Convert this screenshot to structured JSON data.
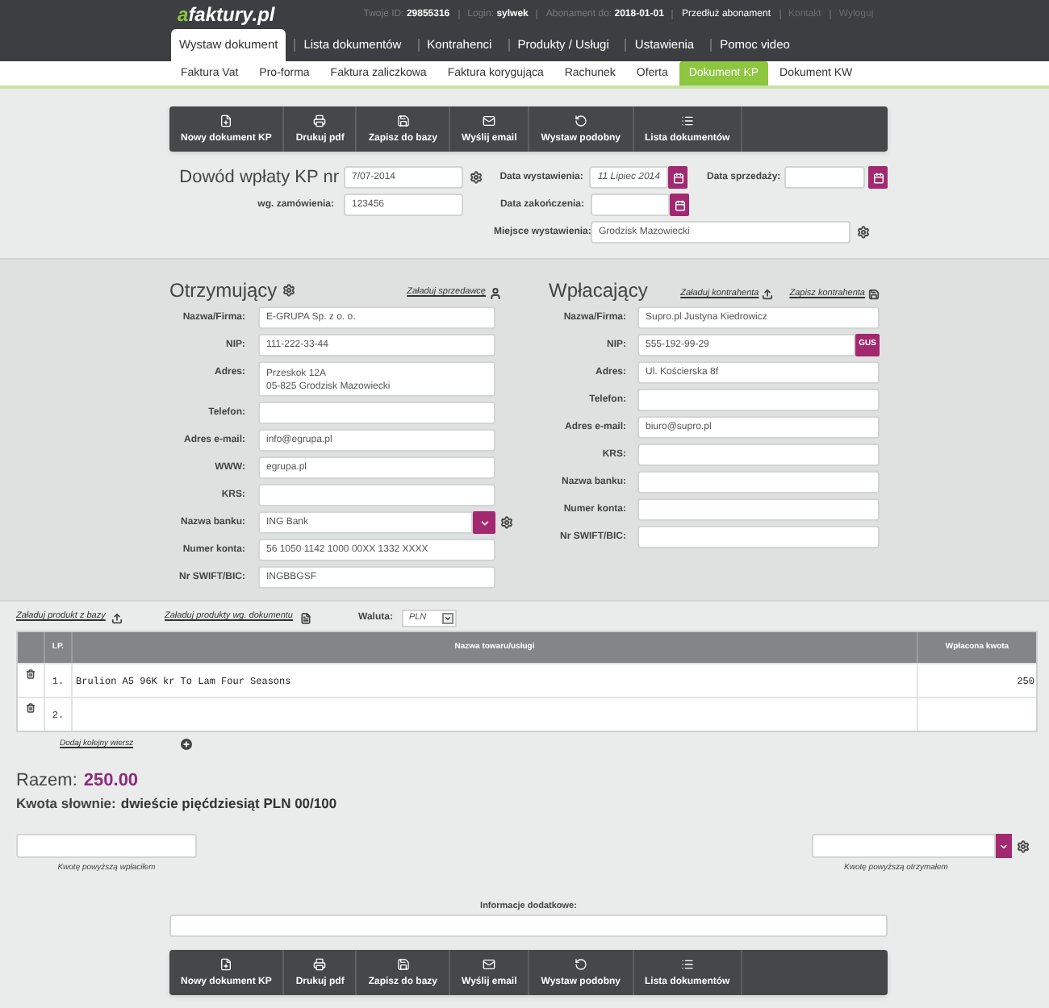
{
  "header": {
    "logo": {
      "accent": "a",
      "text": "faktury.pl"
    },
    "account": [
      {
        "label": "Twoje ID:",
        "value": "29855316"
      },
      {
        "label": "Login:",
        "value": "sylwek"
      },
      {
        "label": "Abonament do:",
        "value": "2018-01-01"
      }
    ],
    "links": [
      {
        "label": "Przedłuż abonament",
        "muted": false
      },
      {
        "label": "Kontakt",
        "muted": true
      },
      {
        "label": "Wyloguj",
        "muted": true
      }
    ],
    "tabs": [
      {
        "label": "Wystaw dokument",
        "selected": true
      },
      {
        "label": "Lista dokumentów",
        "selected": false
      },
      {
        "label": "Kontrahenci",
        "selected": false
      },
      {
        "label": "Produkty / Usługi",
        "selected": false
      },
      {
        "label": "Ustawienia",
        "selected": false
      },
      {
        "label": "Pomoc video",
        "selected": false
      }
    ]
  },
  "subtabs": [
    {
      "label": "Faktura Vat",
      "selected": false
    },
    {
      "label": "Pro-forma",
      "selected": false
    },
    {
      "label": "Faktura zaliczkowa",
      "selected": false
    },
    {
      "label": "Faktura korygująca",
      "selected": false
    },
    {
      "label": "Rachunek",
      "selected": false
    },
    {
      "label": "Oferta",
      "selected": false
    },
    {
      "label": "Dokument KP",
      "selected": true
    },
    {
      "label": "Dokument KW",
      "selected": false
    }
  ],
  "toolbar_top": [
    {
      "kind": "new",
      "label": "Nowy dokument KP"
    },
    {
      "kind": "print",
      "label": "Drukuj pdf"
    },
    {
      "kind": "save",
      "label": "Zapisz do bazy"
    },
    {
      "kind": "email",
      "label": "Wyślij email"
    },
    {
      "kind": "similar",
      "label": "Wystaw podobny"
    },
    {
      "kind": "list",
      "label": "Lista dokumentów"
    }
  ],
  "document": {
    "title": "Dowód wpłaty KP nr",
    "number": "7/07-2014",
    "order_label": "wg. zamówienia:",
    "order": "123456",
    "issue_date": {
      "label": "Data wystawienia:",
      "value": "11 Lipiec 2014"
    },
    "sale_date": {
      "label": "Data sprzedaży:"
    },
    "end_date": {
      "label": "Data zakończenia:"
    },
    "place": {
      "label": "Miejsce wystawienia:",
      "value": "Grodzisk Mazowiecki"
    }
  },
  "receiver": {
    "title": "Otrzymujący",
    "settings": true,
    "links": [
      {
        "label": "Załaduj sprzedawcę",
        "kind": "person"
      }
    ],
    "fields": [
      {
        "label": "Nazwa/Firma:",
        "kind": "text",
        "value": "E-GRUPA Sp. z o. o."
      },
      {
        "label": "NIP:",
        "kind": "text",
        "value": "111-222-33-44"
      },
      {
        "label": "Adres:",
        "kind": "multiline",
        "lines": [
          "Przeskok 12A",
          "05-825 Grodzisk Mazowiecki"
        ]
      },
      {
        "label": "Telefon:",
        "kind": "text"
      },
      {
        "label": "Adres e-mail:",
        "kind": "text",
        "value": "info@egrupa.pl"
      },
      {
        "label": "WWW:",
        "kind": "text",
        "value": "egrupa.pl"
      },
      {
        "label": "KRS:",
        "kind": "text"
      },
      {
        "label": "Nazwa banku:",
        "kind": "select",
        "value": "ING Bank"
      },
      {
        "label": "Numer konta:",
        "kind": "text",
        "value": "56 1050 1142 1000 00XX 1332 XXXX"
      },
      {
        "label": "Nr SWIFT/BIC:",
        "kind": "text",
        "value": "INGBBGSF"
      }
    ]
  },
  "payer": {
    "title": "Wpłacający",
    "settings": false,
    "links": [
      {
        "label": "Załaduj kontrahenta",
        "kind": "upload"
      },
      {
        "label": "Zapisz kontrahenta",
        "kind": "save"
      }
    ],
    "fields": [
      {
        "label": "Nazwa/Firma:",
        "kind": "text",
        "value": "Supro.pl Justyna Kiedrowicz"
      },
      {
        "label": "NIP:",
        "kind": "lookup",
        "value": "555-192-99-29",
        "button": "GUS"
      },
      {
        "label": "Adres:",
        "kind": "text",
        "value": "Ul. Kościerska 8f"
      },
      {
        "label": "Telefon:",
        "kind": "text"
      },
      {
        "label": "Adres e-mail:",
        "kind": "text",
        "value": "biuro@supro.pl"
      },
      {
        "label": "KRS:",
        "kind": "text"
      },
      {
        "label": "Nazwa banku:",
        "kind": "text"
      },
      {
        "label": "Numer konta:",
        "kind": "text"
      },
      {
        "label": "Nr SWIFT/BIC:",
        "kind": "text"
      }
    ]
  },
  "items": {
    "actions": [
      {
        "label": "Załaduj produkt z bazy",
        "kind": "upload"
      },
      {
        "label": "Załaduj produkty wg. dokumentu",
        "kind": "document"
      }
    ],
    "currency": {
      "label": "Waluta:",
      "value": "PLN"
    },
    "table": {
      "columns": [
        "LP.",
        "Nazwa towaru/usługi",
        "Wpłacona kwota"
      ],
      "rows": [
        {
          "lp": "1.",
          "name": "Brulion A5 96K kr To Lam Four Seasons",
          "amount": "250"
        },
        {
          "lp": "2."
        }
      ]
    },
    "add_row": "Dodaj kolejny wiersz"
  },
  "summary": {
    "total_label": "Razem:",
    "total": "250.00",
    "words_label": "Kwota słownie:",
    "words": "dwieście pięćdziesiąt PLN 00/100"
  },
  "signatures": [
    {
      "kind": "input",
      "caption": "Kwotę powyższą wpłaciłem"
    },
    {
      "kind": "select",
      "caption": "Kwotę powyższą otrzymałem"
    }
  ],
  "notes": {
    "label": "Informacje dodatkowe:"
  },
  "toolbar_bottom": [
    {
      "kind": "new",
      "label": "Nowy dokument KP"
    },
    {
      "kind": "print",
      "label": "Drukuj pdf"
    },
    {
      "kind": "save",
      "label": "Zapisz do bazy"
    },
    {
      "kind": "email",
      "label": "Wyślij email"
    },
    {
      "kind": "similar",
      "label": "Wystaw podobny"
    },
    {
      "kind": "list",
      "label": "Lista dokumentów"
    }
  ]
}
